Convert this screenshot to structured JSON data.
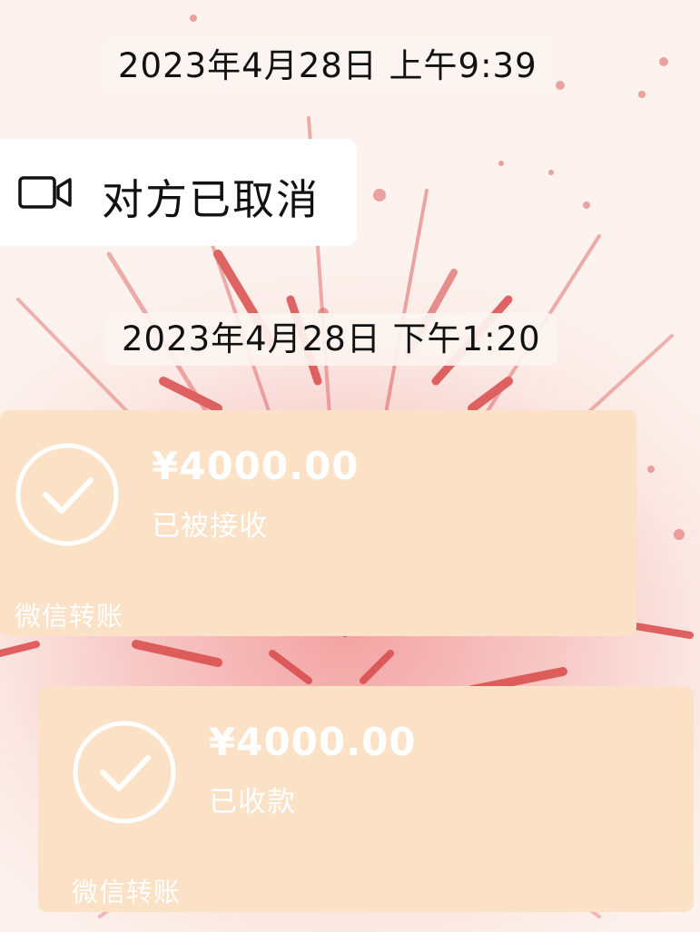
{
  "chat": {
    "timestamp1": "2023年4月28日 上午9:39",
    "call_status": "对方已取消",
    "call_icon": "video-camera-icon",
    "timestamp2": "2023年4月28日 下午1:20"
  },
  "transfers": [
    {
      "amount": "¥4000.00",
      "status": "已被接收",
      "source": "微信转账",
      "icon": "check-circle-icon"
    },
    {
      "amount": "¥4000.00",
      "status": "已收款",
      "source": "微信转账",
      "icon": "check-circle-icon"
    }
  ],
  "colors": {
    "card_background": "#fbe1c6",
    "firework_red": "#d94a4a",
    "background_pink": "#f7c9c7"
  }
}
